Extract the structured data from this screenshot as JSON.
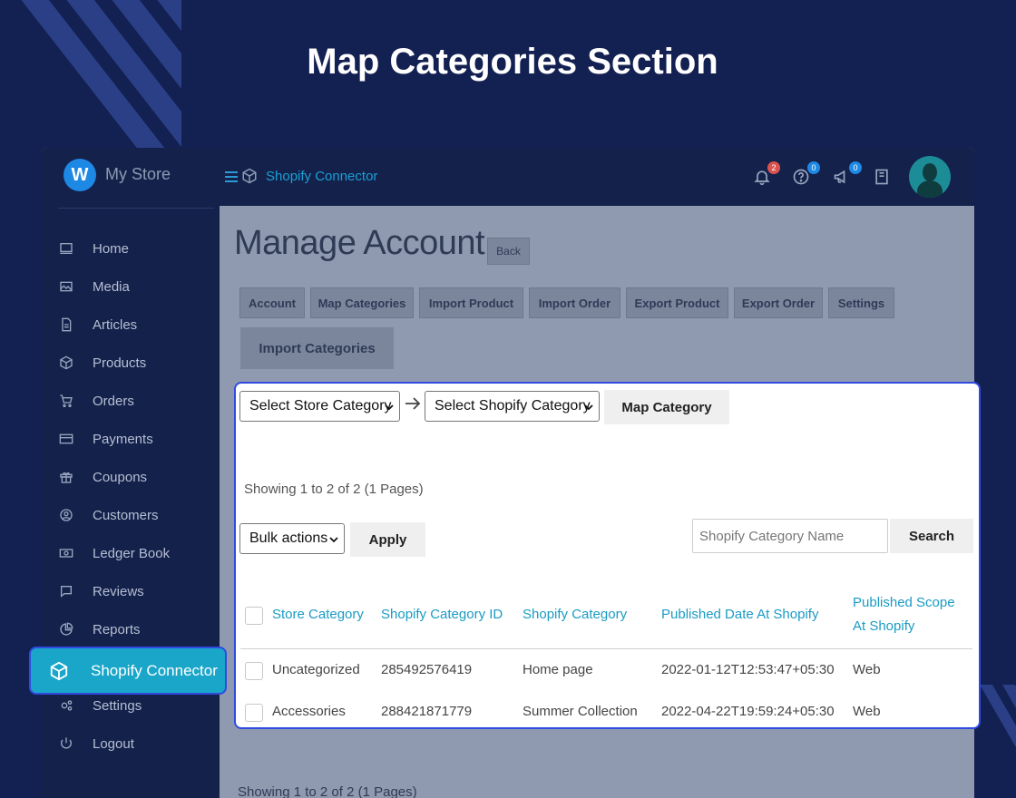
{
  "hero": {
    "title": "Map Categories Section"
  },
  "topbar": {
    "logo_letter": "W",
    "store_name": "My Store",
    "breadcrumb": "Shopify Connector",
    "notifications_count": "2",
    "help_count": "0",
    "announcements_count": "0",
    "colors": {
      "notif_badge": "#d9534f",
      "info_badge": "#1e88e5"
    }
  },
  "sidebar": {
    "items": [
      {
        "label": "Home",
        "icon": "monitor-icon"
      },
      {
        "label": "Media",
        "icon": "image-icon"
      },
      {
        "label": "Articles",
        "icon": "document-icon"
      },
      {
        "label": "Products",
        "icon": "cube-icon"
      },
      {
        "label": "Orders",
        "icon": "cart-icon"
      },
      {
        "label": "Payments",
        "icon": "credit-card-icon"
      },
      {
        "label": "Coupons",
        "icon": "gift-icon"
      },
      {
        "label": "Customers",
        "icon": "user-circle-icon"
      },
      {
        "label": "Ledger Book",
        "icon": "cash-icon"
      },
      {
        "label": "Reviews",
        "icon": "chat-icon"
      },
      {
        "label": "Reports",
        "icon": "pie-chart-icon"
      },
      {
        "label": "Shopify Connector",
        "icon": "cube-icon",
        "active": true
      },
      {
        "label": "Settings",
        "icon": "gears-icon"
      },
      {
        "label": "Logout",
        "icon": "power-icon"
      }
    ]
  },
  "page": {
    "title": "Manage Account",
    "back_label": "Back",
    "tabs": [
      "Account",
      "Map Categories",
      "Import Product",
      "Import Order",
      "Export Product",
      "Export Order",
      "Settings"
    ],
    "import_categories_label": "Import Categories",
    "showing_bottom": "Showing 1 to 2 of 2 (1 Pages)"
  },
  "panel": {
    "store_category_select": "Select Store Category",
    "shopify_category_select": "Select Shopify Category",
    "map_category_label": "Map Category",
    "showing": "Showing 1 to 2 of 2 (1 Pages)",
    "bulk_actions": "Bulk actions",
    "apply_label": "Apply",
    "search_placeholder": "Shopify Category Name",
    "search_label": "Search",
    "columns": [
      "Store Category",
      "Shopify Category ID",
      "Shopify Category",
      "Published Date At Shopify",
      "Published Scope",
      "At Shopify"
    ],
    "rows": [
      {
        "store_category": "Uncategorized",
        "shopify_id": "285492576419",
        "shopify_category": "Home page",
        "published_date": "2022-01-12T12:53:47+05:30",
        "scope": "Web"
      },
      {
        "store_category": "Accessories",
        "shopify_id": "288421871779",
        "shopify_category": "Summer Collection",
        "published_date": "2022-04-22T19:59:24+05:30",
        "scope": "Web"
      }
    ]
  }
}
